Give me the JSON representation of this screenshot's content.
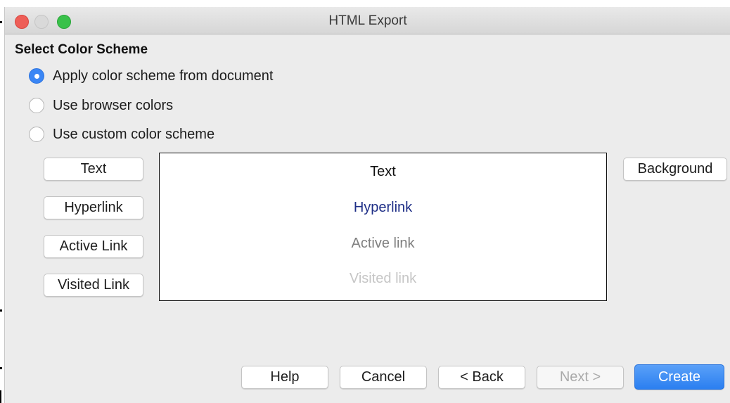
{
  "window": {
    "title": "HTML Export"
  },
  "section": {
    "title": "Select Color Scheme"
  },
  "scheme_options": [
    {
      "label": "Apply color scheme from document",
      "checked": true
    },
    {
      "label": "Use browser colors",
      "checked": false
    },
    {
      "label": "Use custom color scheme",
      "checked": false
    }
  ],
  "color_buttons": {
    "text": "Text",
    "hyperlink": "Hyperlink",
    "active_link": "Active Link",
    "visited_link": "Visited Link",
    "background": "Background"
  },
  "preview": {
    "text": "Text",
    "hyperlink": "Hyperlink",
    "active_link": "Active link",
    "visited_link": "Visited link",
    "colors": {
      "text": "#111111",
      "hyperlink": "#1f2f87",
      "active_link": "#7f7f7f",
      "visited_link": "#c6c6c6"
    }
  },
  "footer": {
    "help": "Help",
    "cancel": "Cancel",
    "back": "< Back",
    "next": "Next >",
    "create": "Create",
    "next_disabled": true
  },
  "colors": {
    "accent": "#2b7ff0",
    "radio_selected": "#3a86f5"
  }
}
